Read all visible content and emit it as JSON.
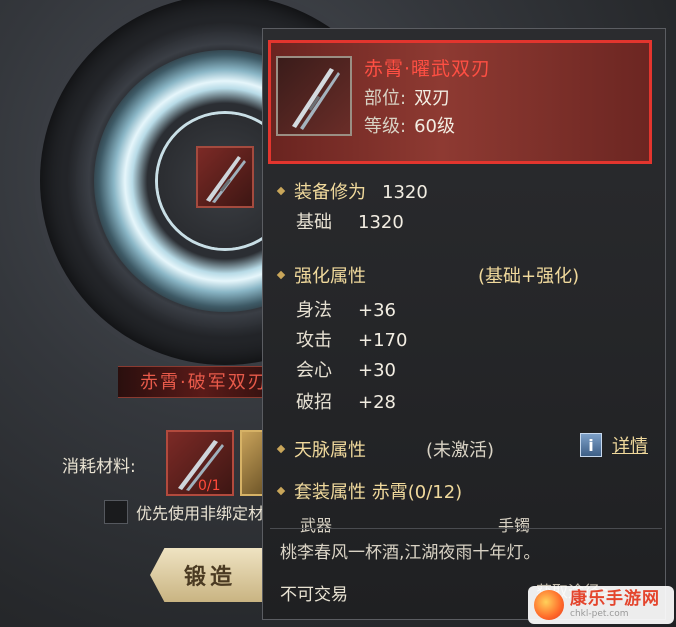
{
  "forge": {
    "banner_name": "赤霄·破军双刃",
    "materials_label": "消耗材料:",
    "material_count": "0/1",
    "prefer_unbound_label": "优先使用非绑定材料",
    "forge_button": "锻造"
  },
  "tooltip": {
    "name": "赤霄·曜武双刃",
    "slot_label": "部位:",
    "slot_value": "双刃",
    "level_label": "等级:",
    "level_value": "60级",
    "equip_power_label": "装备修为",
    "equip_power_value": "1320",
    "base_label": "基础",
    "base_value": "1320",
    "enhance_label": "强化属性",
    "enhance_note": "(基础+强化)",
    "stats": [
      {
        "name": "身法",
        "value": "+36"
      },
      {
        "name": "攻击",
        "value": "+170"
      },
      {
        "name": "会心",
        "value": "+30"
      },
      {
        "name": "破招",
        "value": "+28"
      }
    ],
    "meridian_label": "天脉属性",
    "meridian_note": "(未激活)",
    "detail_label": "详情",
    "set_label": "套装属性 赤霄(0/12)",
    "set_items": [
      "武器",
      "手镯"
    ],
    "flavor": "桃李春风一杯酒,江湖夜雨十年灯。",
    "tradable": "不可交易",
    "acquire": "获取途径>"
  },
  "watermark": {
    "title": "康乐手游网",
    "url": "chkl-pet.com"
  },
  "colors": {
    "item_name_red": "#ff4f43",
    "highlight_border": "#e3352e",
    "section_gold": "#f0d99c"
  }
}
